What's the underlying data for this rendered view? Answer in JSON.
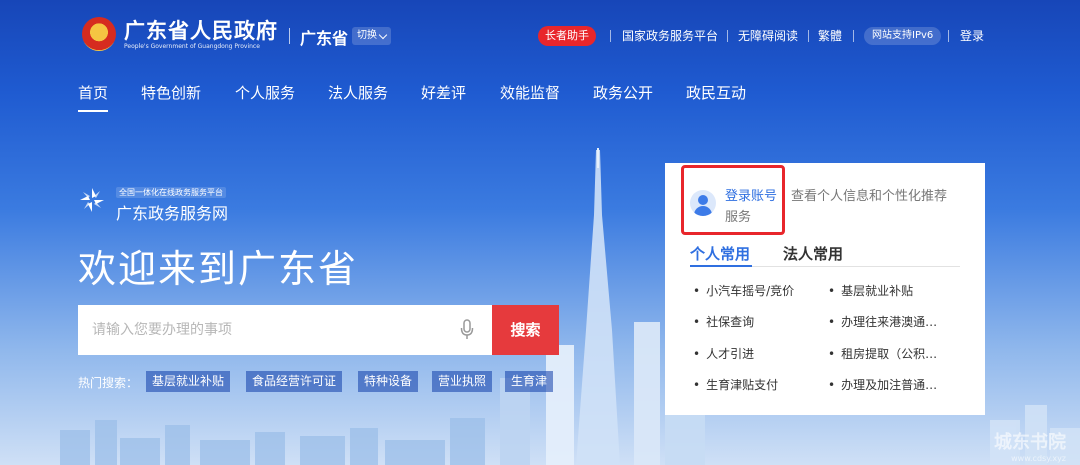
{
  "header": {
    "brand_cn": "广东省人民政府",
    "brand_en": "People's Government of Guangdong Province",
    "region": "广东省",
    "switch_label": "切换",
    "elder_helper": "长者助手",
    "links": [
      "国家政务服务平台",
      "无障碍阅读",
      "繁體"
    ],
    "ipv6": "网站支持IPv6",
    "login": "登录"
  },
  "nav": {
    "items": [
      "首页",
      "特色创新",
      "个人服务",
      "法人服务",
      "好差评",
      "效能监督",
      "政务公开",
      "政民互动"
    ],
    "active_index": 0
  },
  "hero": {
    "portal_subtitle": "全国一体化在线政务服务平台",
    "portal_name": "广东政务服务网",
    "welcome": "欢迎来到广东省",
    "search_placeholder": "请输入您要办理的事项",
    "search_button": "搜索",
    "hot_label": "热门搜索：",
    "hot_tags": [
      "基层就业补贴",
      "食品经营许可证",
      "特种设备",
      "营业执照",
      "生育津"
    ]
  },
  "card": {
    "login_link": "登录账号",
    "login_desc_line1": "查看个人信息和个性化推荐",
    "login_desc_line2": "服务",
    "tabs": [
      "个人常用",
      "法人常用"
    ],
    "active_tab": 0,
    "services_left": [
      "小汽车摇号/竞价",
      "社保查询",
      "人才引进",
      "生育津贴支付"
    ],
    "services_right": [
      "基层就业补贴",
      "办理往来港澳通…",
      "租房提取（公积…",
      "办理及加注普通…"
    ]
  },
  "watermark": {
    "text": "城东书院",
    "url": "www.cdsy.xyz"
  },
  "colors": {
    "primary_blue": "#1f5bd1",
    "accent_red": "#e8262b",
    "link_blue": "#2f6fe0"
  }
}
